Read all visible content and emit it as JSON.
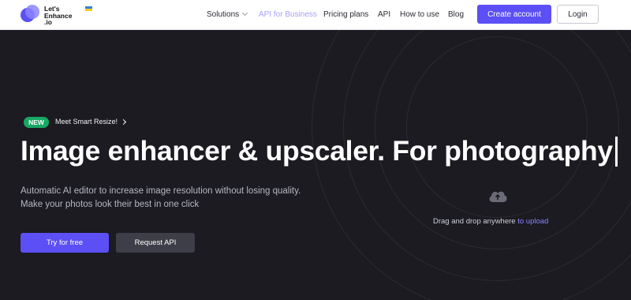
{
  "logo": {
    "line1": "Let's",
    "line2": "Enhance",
    "line3": ".io"
  },
  "nav": {
    "solutions": "Solutions",
    "business": "API for Business",
    "pricing": "Pricing plans",
    "api": "API",
    "howto": "How to use",
    "blog": "Blog"
  },
  "header_buttons": {
    "create": "Create account",
    "login": "Login"
  },
  "badge": {
    "tag": "NEW",
    "text": "Meet Smart Resize!"
  },
  "hero": {
    "headline": "Image enhancer & upscaler. For photography",
    "sub1": "Automatic AI editor to increase image resolution without losing quality.",
    "sub2": "Make your photos look their best in one click"
  },
  "cta": {
    "try": "Try for free",
    "api": "Request API"
  },
  "upload": {
    "text": "Drag and drop anywhere ",
    "link": "to upload"
  },
  "colors": {
    "accent": "#5b4ff5",
    "hero_bg": "#1b1b21",
    "new_badge": "#17a864"
  }
}
